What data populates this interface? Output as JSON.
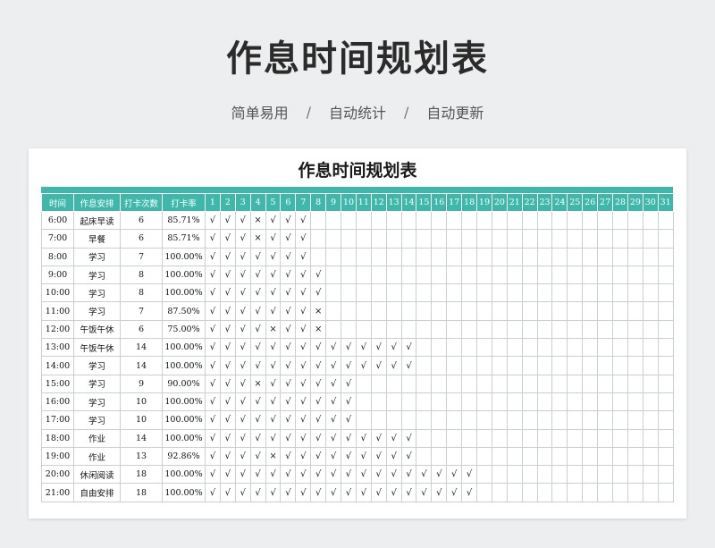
{
  "page": {
    "title": "作息时间规划表",
    "subtitle": [
      "简单易用",
      "自动统计",
      "自动更新"
    ],
    "separator": "/"
  },
  "sheet": {
    "title": "作息时间规划表",
    "headers": [
      "时间",
      "作息安排",
      "打卡次数",
      "打卡率"
    ],
    "days": [
      "1",
      "2",
      "3",
      "4",
      "5",
      "6",
      "7",
      "8",
      "9",
      "10",
      "11",
      "12",
      "13",
      "14",
      "15",
      "16",
      "17",
      "18",
      "19",
      "20",
      "21",
      "22",
      "23",
      "24",
      "25",
      "26",
      "27",
      "28",
      "29",
      "30",
      "31"
    ],
    "rows": [
      {
        "time": "6:00",
        "activity": "起床早读",
        "count": "6",
        "rate": "85.71%",
        "marks": [
          "√",
          "√",
          "√",
          "×",
          "√",
          "√",
          "√"
        ]
      },
      {
        "time": "7:00",
        "activity": "早餐",
        "count": "6",
        "rate": "85.71%",
        "marks": [
          "√",
          "√",
          "√",
          "×",
          "√",
          "√",
          "√"
        ]
      },
      {
        "time": "8:00",
        "activity": "学习",
        "count": "7",
        "rate": "100.00%",
        "marks": [
          "√",
          "√",
          "√",
          "√",
          "√",
          "√",
          "√"
        ]
      },
      {
        "time": "9:00",
        "activity": "学习",
        "count": "8",
        "rate": "100.00%",
        "marks": [
          "√",
          "√",
          "√",
          "√",
          "√",
          "√",
          "√",
          "√"
        ]
      },
      {
        "time": "10:00",
        "activity": "学习",
        "count": "8",
        "rate": "100.00%",
        "marks": [
          "√",
          "√",
          "√",
          "√",
          "√",
          "√",
          "√",
          "√"
        ]
      },
      {
        "time": "11:00",
        "activity": "学习",
        "count": "7",
        "rate": "87.50%",
        "marks": [
          "√",
          "√",
          "√",
          "√",
          "√",
          "√",
          "√",
          "×"
        ]
      },
      {
        "time": "12:00",
        "activity": "午饭午休",
        "count": "6",
        "rate": "75.00%",
        "marks": [
          "√",
          "√",
          "√",
          "√",
          "×",
          "√",
          "√",
          "×"
        ]
      },
      {
        "time": "13:00",
        "activity": "午饭午休",
        "count": "14",
        "rate": "100.00%",
        "marks": [
          "√",
          "√",
          "√",
          "√",
          "√",
          "√",
          "√",
          "√",
          "√",
          "√",
          "√",
          "√",
          "√",
          "√"
        ]
      },
      {
        "time": "14:00",
        "activity": "学习",
        "count": "14",
        "rate": "100.00%",
        "marks": [
          "√",
          "√",
          "√",
          "√",
          "√",
          "√",
          "√",
          "√",
          "√",
          "√",
          "√",
          "√",
          "√",
          "√"
        ]
      },
      {
        "time": "15:00",
        "activity": "学习",
        "count": "9",
        "rate": "90.00%",
        "marks": [
          "√",
          "√",
          "√",
          "×",
          "√",
          "√",
          "√",
          "√",
          "√",
          "√"
        ]
      },
      {
        "time": "16:00",
        "activity": "学习",
        "count": "10",
        "rate": "100.00%",
        "marks": [
          "√",
          "√",
          "√",
          "√",
          "√",
          "√",
          "√",
          "√",
          "√",
          "√"
        ]
      },
      {
        "time": "17:00",
        "activity": "学习",
        "count": "10",
        "rate": "100.00%",
        "marks": [
          "√",
          "√",
          "√",
          "√",
          "√",
          "√",
          "√",
          "√",
          "√",
          "√"
        ]
      },
      {
        "time": "18:00",
        "activity": "作业",
        "count": "14",
        "rate": "100.00%",
        "marks": [
          "√",
          "√",
          "√",
          "√",
          "√",
          "√",
          "√",
          "√",
          "√",
          "√",
          "√",
          "√",
          "√",
          "√"
        ]
      },
      {
        "time": "19:00",
        "activity": "作业",
        "count": "13",
        "rate": "92.86%",
        "marks": [
          "√",
          "√",
          "√",
          "√",
          "×",
          "√",
          "√",
          "√",
          "√",
          "√",
          "√",
          "√",
          "√",
          "√"
        ]
      },
      {
        "time": "20:00",
        "activity": "休闲阅读",
        "count": "18",
        "rate": "100.00%",
        "marks": [
          "√",
          "√",
          "√",
          "√",
          "√",
          "√",
          "√",
          "√",
          "√",
          "√",
          "√",
          "√",
          "√",
          "√",
          "√",
          "√",
          "√",
          "√"
        ]
      },
      {
        "time": "21:00",
        "activity": "自由安排",
        "count": "18",
        "rate": "100.00%",
        "marks": [
          "√",
          "√",
          "√",
          "√",
          "√",
          "√",
          "√",
          "√",
          "√",
          "√",
          "√",
          "√",
          "√",
          "√",
          "√",
          "√",
          "√",
          "√"
        ]
      }
    ]
  },
  "colors": {
    "accent": "#3fb7aa",
    "background": "#eceef0",
    "grid": "#c9cfd2"
  }
}
